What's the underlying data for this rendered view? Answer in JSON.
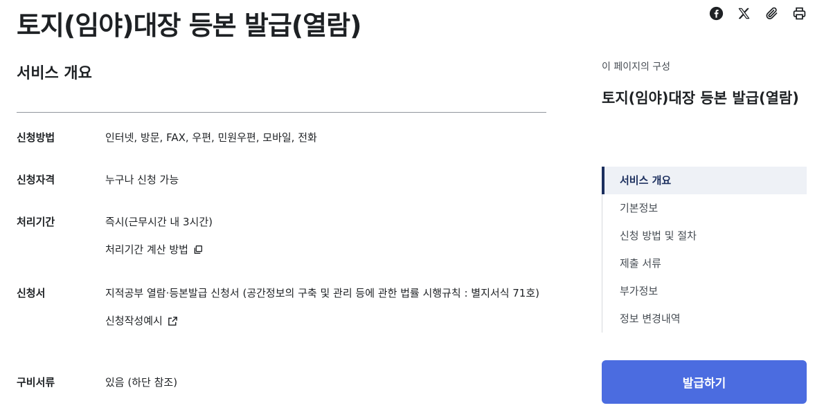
{
  "page": {
    "title": "토지(임야)대장 등본 발급(열람)"
  },
  "share": {
    "icons": [
      "facebook-icon",
      "x-twitter-icon",
      "paperclip-icon",
      "printer-icon"
    ]
  },
  "overview": {
    "heading": "서비스 개요",
    "rows": [
      {
        "label": "신청방법",
        "value": "인터넷, 방문, FAX, 우편, 민원우편, 모바일, 전화"
      },
      {
        "label": "신청자격",
        "value": "누구나 신청 가능"
      },
      {
        "label": "처리기간",
        "value": "즉시(근무시간 내 3시간)",
        "sub": "처리기간 계산 방법"
      },
      {
        "label": "신청서",
        "value": "지적공부 열람·등본발급 신청서 (공간정보의 구축 및 관리 등에 관한 법률 시행규칙 : 별지서식 71호)",
        "sub": "신청작성예시"
      },
      {
        "label": "구비서류",
        "value": "있음 (하단 참조)"
      }
    ]
  },
  "toc": {
    "caption": "이 페이지의 구성",
    "title": "토지(임야)대장 등본 발급(열람)",
    "items": [
      "서비스 개요",
      "기본정보",
      "신청 방법 및 절차",
      "제출 서류",
      "부가정보",
      "정보 변경내역"
    ],
    "active_index": 0
  },
  "action": {
    "label": "발급하기"
  },
  "colors": {
    "primary": "#4b6ce0",
    "active_nav": "#1c2f5e",
    "active_bg": "#eef1f6"
  }
}
